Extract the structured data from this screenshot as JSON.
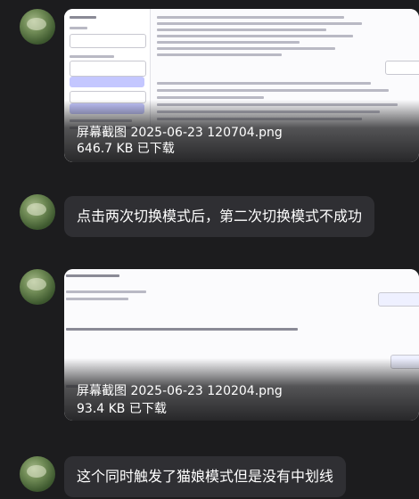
{
  "messages": [
    {
      "type": "image",
      "file_name": "屏幕截图 2025-06-23 120704.png",
      "file_status": "646.7 KB 已下载"
    },
    {
      "type": "text",
      "text": "点击两次切换模式后，第二次切换模式不成功"
    },
    {
      "type": "image",
      "file_name": "屏幕截图 2025-06-23 120204.png",
      "file_status": "93.4 KB 已下载"
    },
    {
      "type": "text",
      "text": "这个同时触发了猫娘模式但是没有中划线"
    }
  ],
  "colors": {
    "background": "#1c1c1e",
    "bubble": "#2f2f33",
    "text": "#ffffff"
  }
}
